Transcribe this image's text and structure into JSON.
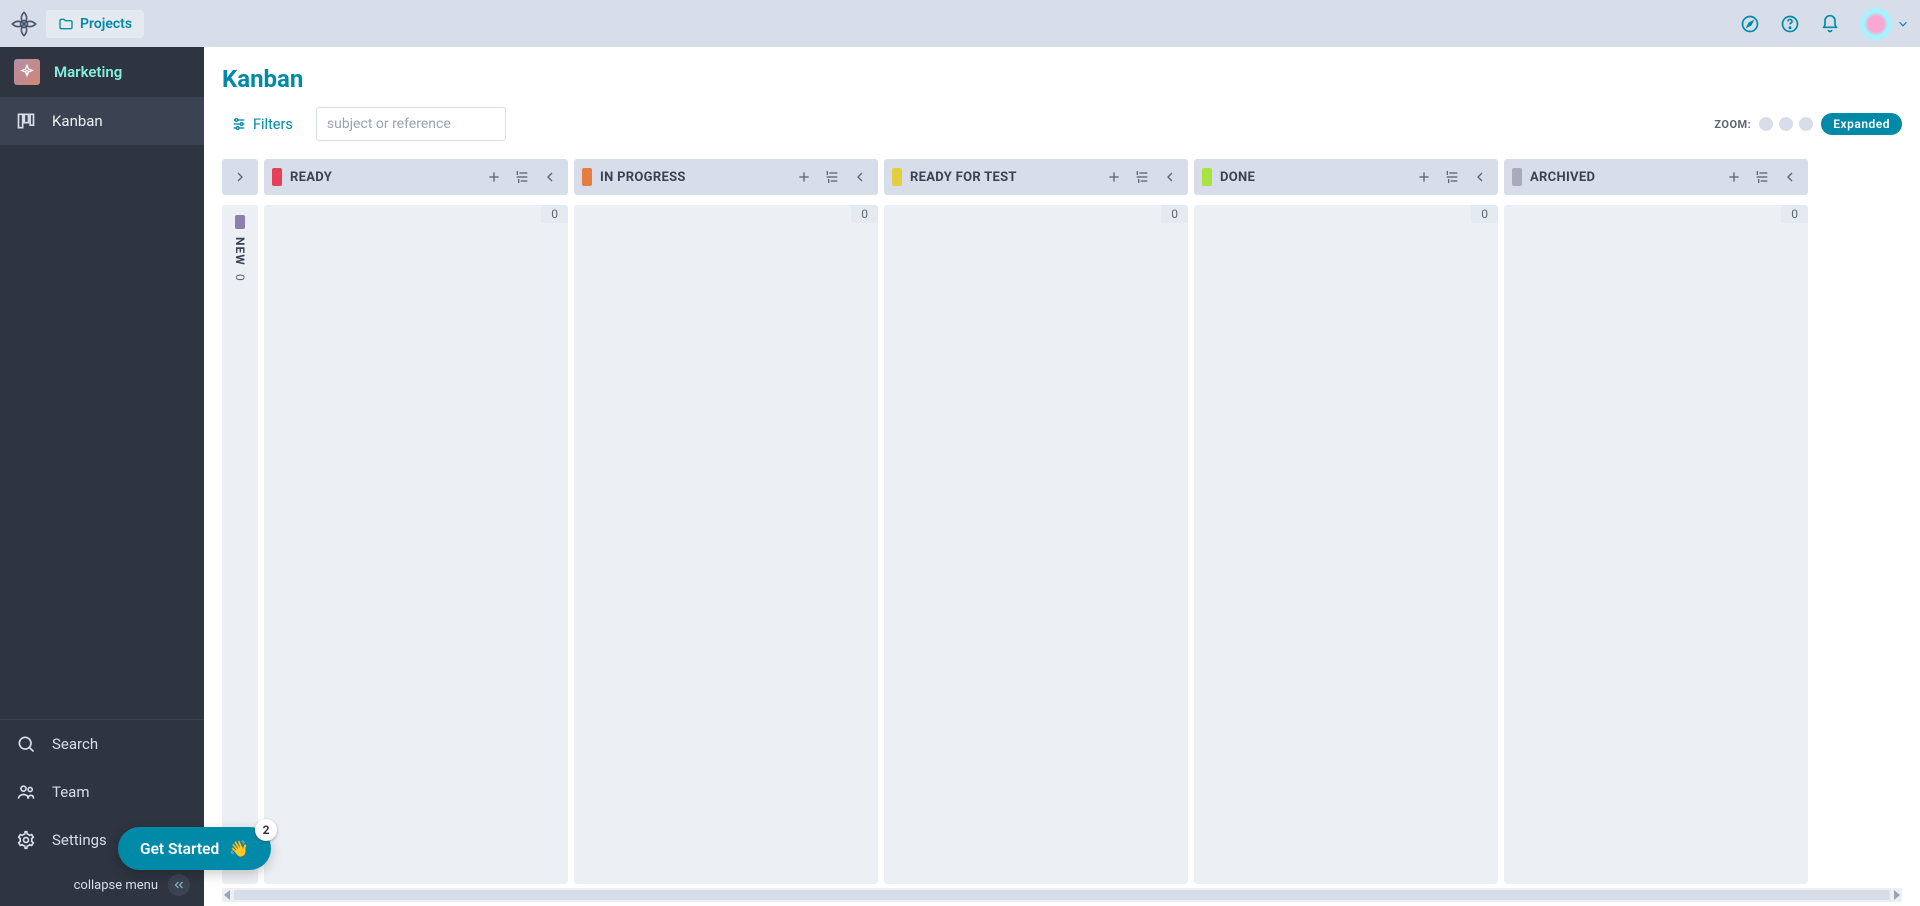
{
  "topbar": {
    "projects_label": "Projects"
  },
  "sidebar": {
    "project_name": "Marketing",
    "nav": {
      "kanban": "Kanban",
      "search": "Search",
      "team": "Team",
      "settings": "Settings"
    },
    "collapse_label": "collapse menu"
  },
  "page": {
    "title": "Kanban"
  },
  "toolbar": {
    "filters_label": "Filters",
    "search_placeholder": "subject or reference",
    "zoom_label": "ZOOM:",
    "zoom_mode": "Expanded"
  },
  "board": {
    "collapsed_column": {
      "name": "NEW",
      "count": 0,
      "color": "#8a7fae"
    },
    "columns": [
      {
        "name": "READY",
        "count": 0,
        "color": "#e44057"
      },
      {
        "name": "IN PROGRESS",
        "count": 0,
        "color": "#e47d40"
      },
      {
        "name": "READY FOR TEST",
        "count": 0,
        "color": "#e4ce40"
      },
      {
        "name": "DONE",
        "count": 0,
        "color": "#a8e440"
      },
      {
        "name": "ARCHIVED",
        "count": 0,
        "color": "#a9aabc"
      }
    ]
  },
  "get_started": {
    "label": "Get Started",
    "emoji": "👋",
    "badge": "2"
  }
}
